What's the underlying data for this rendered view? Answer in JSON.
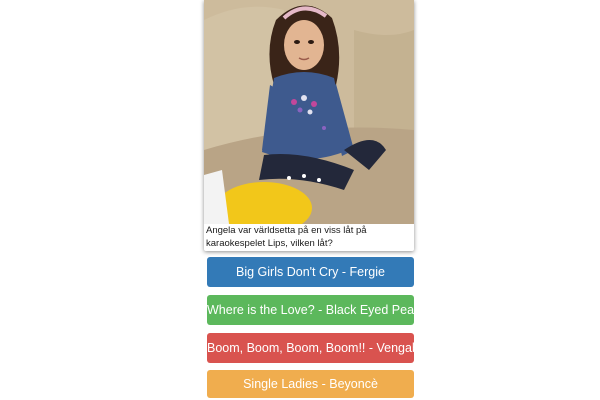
{
  "question": {
    "photo_alt": "Angela",
    "caption": "Angela var världsetta på en viss låt på karaokespelet Lips, vilken låt?"
  },
  "answers": [
    {
      "label": "Big Girls Don't Cry - Fergie",
      "color": "#337ab7"
    },
    {
      "label": "Where is the Love? - Black Eyed Peas",
      "color": "#5cb85c"
    },
    {
      "label": "Boom, Boom, Boom, Boom!! - Vengaboys",
      "color": "#d9534f"
    },
    {
      "label": "Single Ladies - Beyoncè",
      "color": "#f0ad4e"
    }
  ]
}
